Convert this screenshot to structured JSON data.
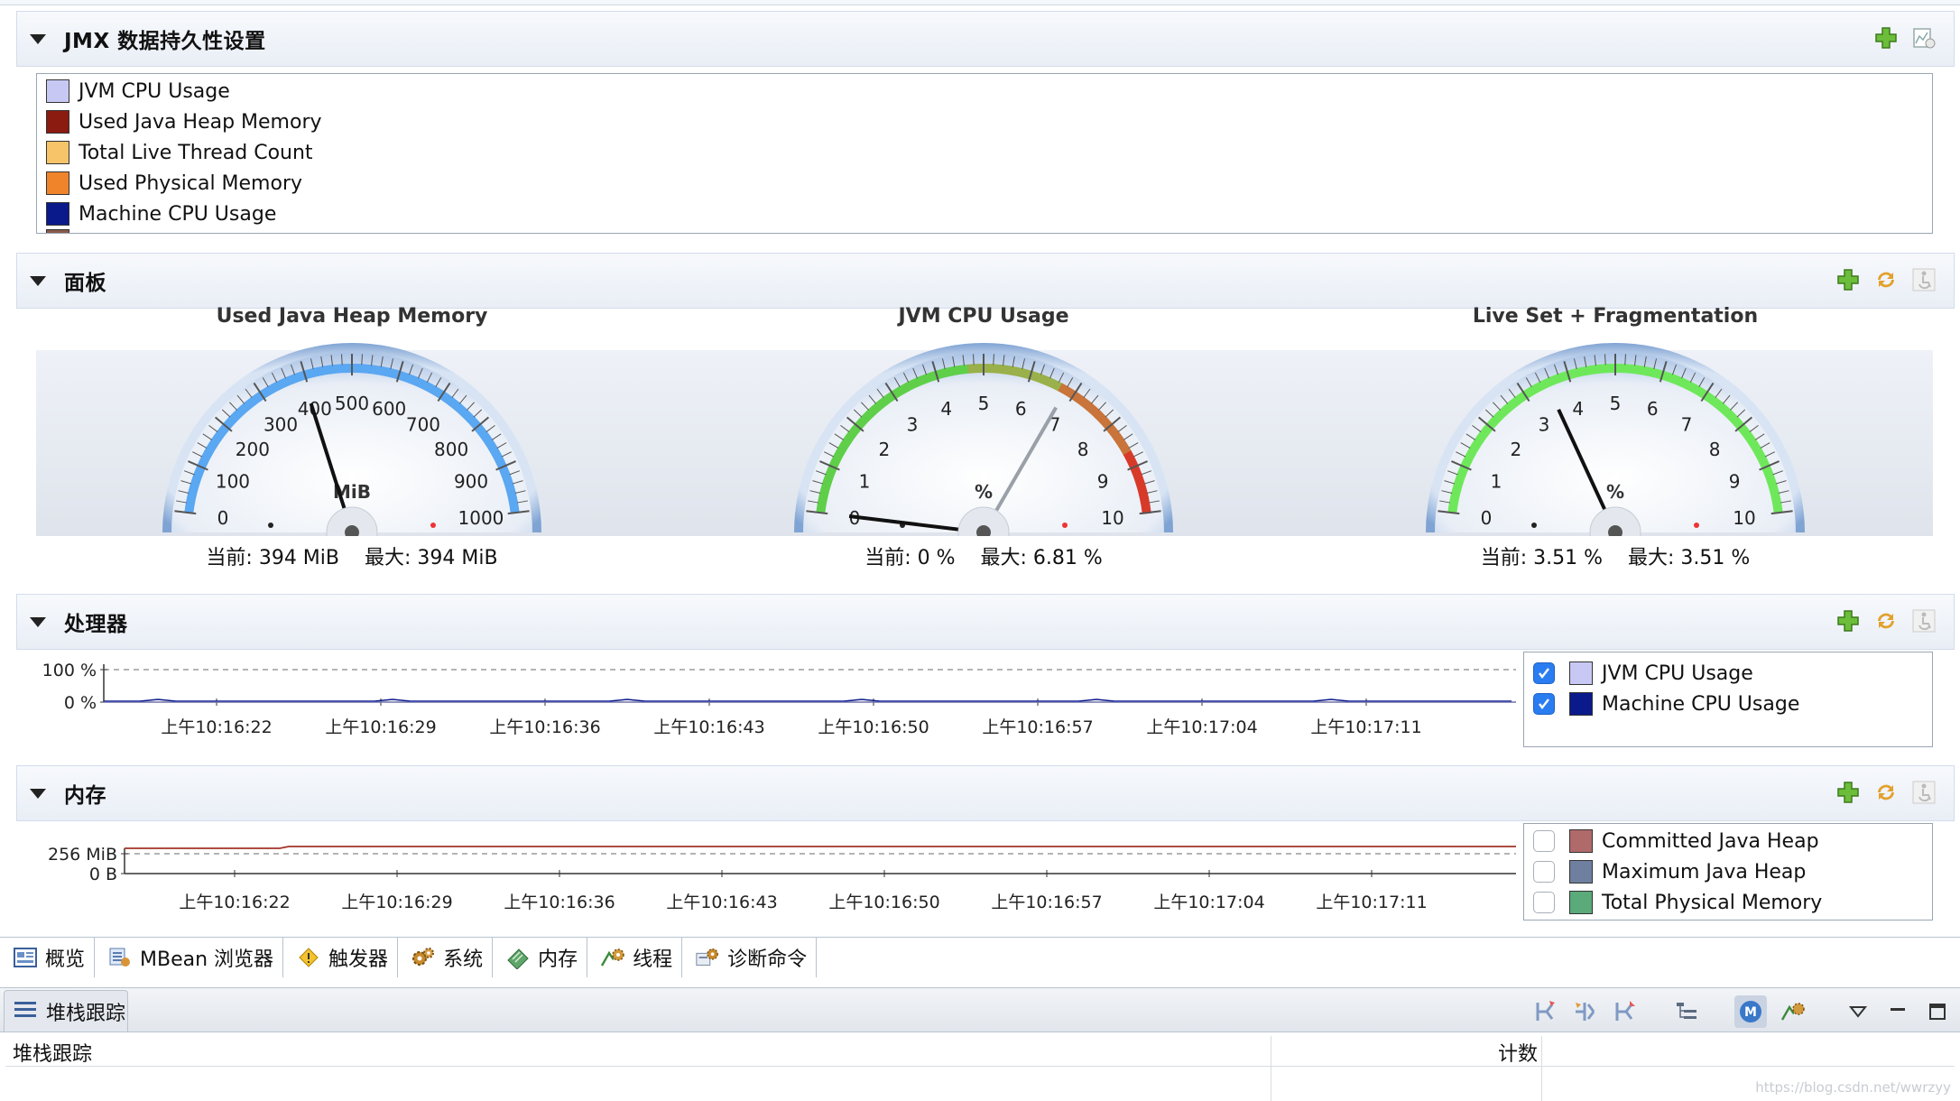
{
  "sections": {
    "jmx": {
      "title": "JMX 数据持久性设置",
      "attributes": [
        {
          "label": "JVM CPU Usage",
          "color": "#c8c8f4"
        },
        {
          "label": "Used Java Heap Memory",
          "color": "#8b1a10"
        },
        {
          "label": "Total Live Thread Count",
          "color": "#f8c46a"
        },
        {
          "label": "Used Physical Memory",
          "color": "#f0842a"
        },
        {
          "label": "Machine CPU Usage",
          "color": "#0a1a8a"
        }
      ]
    },
    "dashboard": {
      "title": "面板",
      "gauges": [
        {
          "title": "Used Java Heap Memory",
          "unit": "MiB",
          "ticks": [
            "0",
            "100",
            "200",
            "300",
            "400",
            "500",
            "600",
            "700",
            "800",
            "900",
            "1000"
          ],
          "max_scale": 1000,
          "current_value": 394,
          "max_value": 394,
          "readout": "当前: 394 MiB    最大: 394 MiB",
          "band": "blue"
        },
        {
          "title": "JVM CPU Usage",
          "unit": "%",
          "ticks": [
            "0",
            "1",
            "2",
            "3",
            "4",
            "5",
            "6",
            "7",
            "8",
            "9",
            "10"
          ],
          "max_scale": 10,
          "current_value": 0,
          "max_value": 6.81,
          "readout": "当前: 0 %    最大: 6.81 %",
          "band": "green-red"
        },
        {
          "title": "Live Set + Fragmentation",
          "unit": "%",
          "ticks": [
            "0",
            "1",
            "2",
            "3",
            "4",
            "5",
            "6",
            "7",
            "8",
            "9",
            "10"
          ],
          "max_scale": 10,
          "current_value": 3.51,
          "max_value": 3.51,
          "readout": "当前: 3.51 %    最大: 3.51 %",
          "band": "green"
        }
      ]
    },
    "processor": {
      "title": "处理器",
      "y_ticks": [
        "100 %",
        "0 %"
      ],
      "x_ticks": [
        "上午10:16:22",
        "上午10:16:29",
        "上午10:16:36",
        "上午10:16:43",
        "上午10:16:50",
        "上午10:16:57",
        "上午10:17:04",
        "上午10:17:11"
      ],
      "legend": [
        {
          "label": "JVM CPU Usage",
          "color": "#c8c8f4",
          "checked": true
        },
        {
          "label": "Machine CPU Usage",
          "color": "#0a1a8a",
          "checked": true
        }
      ]
    },
    "memory": {
      "title": "内存",
      "y_ticks": [
        "256 MiB",
        "0 B"
      ],
      "x_ticks": [
        "上午10:16:22",
        "上午10:16:29",
        "上午10:16:36",
        "上午10:16:43",
        "上午10:16:50",
        "上午10:16:57",
        "上午10:17:04",
        "上午10:17:11"
      ],
      "legend": [
        {
          "label": "Committed Java Heap",
          "color": "#b06a6a",
          "checked": false
        },
        {
          "label": "Maximum Java Heap",
          "color": "#6f7f9f",
          "checked": false
        },
        {
          "label": "Total Physical Memory",
          "color": "#5aaa7a",
          "checked": false
        }
      ]
    }
  },
  "tabs": [
    {
      "label": "概览",
      "icon": "overview-icon",
      "active": true
    },
    {
      "label": "MBean 浏览器",
      "icon": "mbean-browser-icon"
    },
    {
      "label": "触发器",
      "icon": "trigger-warning-icon"
    },
    {
      "label": "系统",
      "icon": "system-gears-icon"
    },
    {
      "label": "内存",
      "icon": "memory-icon"
    },
    {
      "label": "线程",
      "icon": "threads-icon"
    },
    {
      "label": "诊断命令",
      "icon": "diagnostic-commands-icon"
    }
  ],
  "stack_view": {
    "title": "堆栈跟踪",
    "col_stack": "堆栈跟踪",
    "col_count": "计数"
  },
  "watermark": "https://blog.csdn.net/wwrzyy"
}
